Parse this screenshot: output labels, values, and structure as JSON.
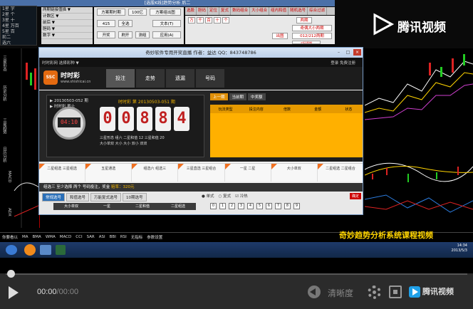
{
  "software": {
    "window_title": "[选股K线]趋势分析 后二",
    "tree_items": [
      "1星 字",
      "2星 个",
      "3星 十",
      "4星 万百",
      "5星 百",
      "前二",
      "选六"
    ],
    "panel_a": [
      "两期链接值描 ▼",
      "计数区 ▼",
      "前后 ▼",
      "胆码 ▼",
      "数字 ▼"
    ],
    "panel_b_buttons": [
      "方案期时期",
      "100亿",
      "方案组出图",
      "415",
      "全选",
      "开奖",
      "刷开",
      "测组",
      "应用(A)",
      "文本(T)"
    ],
    "top_menu": [
      "选股",
      "胆码",
      "定位",
      "复式",
      "数码组合",
      "大小组合",
      "组内和值",
      "随机选号",
      "综合过滤"
    ],
    "panel_c_buttons": [
      "万",
      "千",
      "百",
      "十",
      "个",
      "两期",
      "奇偶大小两期",
      "出图",
      "012/212两期",
      "对码两期"
    ],
    "logo_text": "腾讯视频",
    "left_axis_labels": [
      "三星形态",
      "历史分析",
      "三星趋势",
      "日历分析",
      "MACD",
      "ADX"
    ],
    "bottom_indicators": [
      "你要看以",
      "MA",
      "BMA",
      "WMA",
      "MACD",
      "CCI",
      "SAR",
      "ASI",
      "BBI",
      "RSI",
      "无指标",
      "参数设置"
    ],
    "caption": "奇妙趋势分析系统课程视频",
    "tray_time": "14:34",
    "tray_date": "2013/5/3"
  },
  "browser": {
    "title": "奇妙软件专用开奖直播  作者：益达  QQ：843748786",
    "nav_left": "时时彩网  选择彩种 ▼",
    "nav_right": "登录  免费注册",
    "site_name": "时时彩",
    "site_url": "www.shishicai.cn",
    "tabs": [
      "投注",
      "走势",
      "遗漏",
      "号码"
    ],
    "issue_lines": [
      "▶ 20130503-052 期",
      "▶ 时时彩 截止"
    ],
    "countdown": "04:10",
    "draw_title": "时时彩  第 20130503-051 期",
    "digits": [
      "0",
      "0",
      "8",
      "8",
      "4"
    ],
    "result_lines": [
      "三星形态  组六    二星和值  12    三星和值  20",
      "大小单双  大小  大小  双小  双双"
    ],
    "right_tabs": [
      "上一期",
      "当前期",
      "中奖额"
    ],
    "right_headers": [
      "玩法类型",
      "投注内容",
      "倍数",
      "金额",
      "状态"
    ],
    "strip_items": [
      "二星组选 三星组选",
      "五星通选",
      "组选六 组选三",
      "三星直选 三星组合",
      "一星 二星",
      "大小单双",
      "二星组选 二星组合"
    ],
    "picker_bar": "组选三  至少选择 两个 号码投注，奖金 ",
    "picker_highlight": "赔率：320元",
    "picker_tabs": [
      "常规选号",
      "和值选号",
      "万能复式选号",
      "10期选号"
    ],
    "picker_cols": [
      "大小单双",
      "一星",
      "二星和值",
      "二星组选"
    ],
    "picker_opts": [
      "● 单式",
      "○ 复式",
      "☑ 冷热"
    ],
    "balls": [
      "0",
      "1",
      "2",
      "3",
      "4",
      "5",
      "6",
      "7",
      "8",
      "9"
    ],
    "confirm": "确定"
  },
  "player": {
    "current_time": "00:00",
    "duration": "/00:00",
    "quality": "清晰度",
    "brand": "腾讯视频",
    "progress": 0
  }
}
